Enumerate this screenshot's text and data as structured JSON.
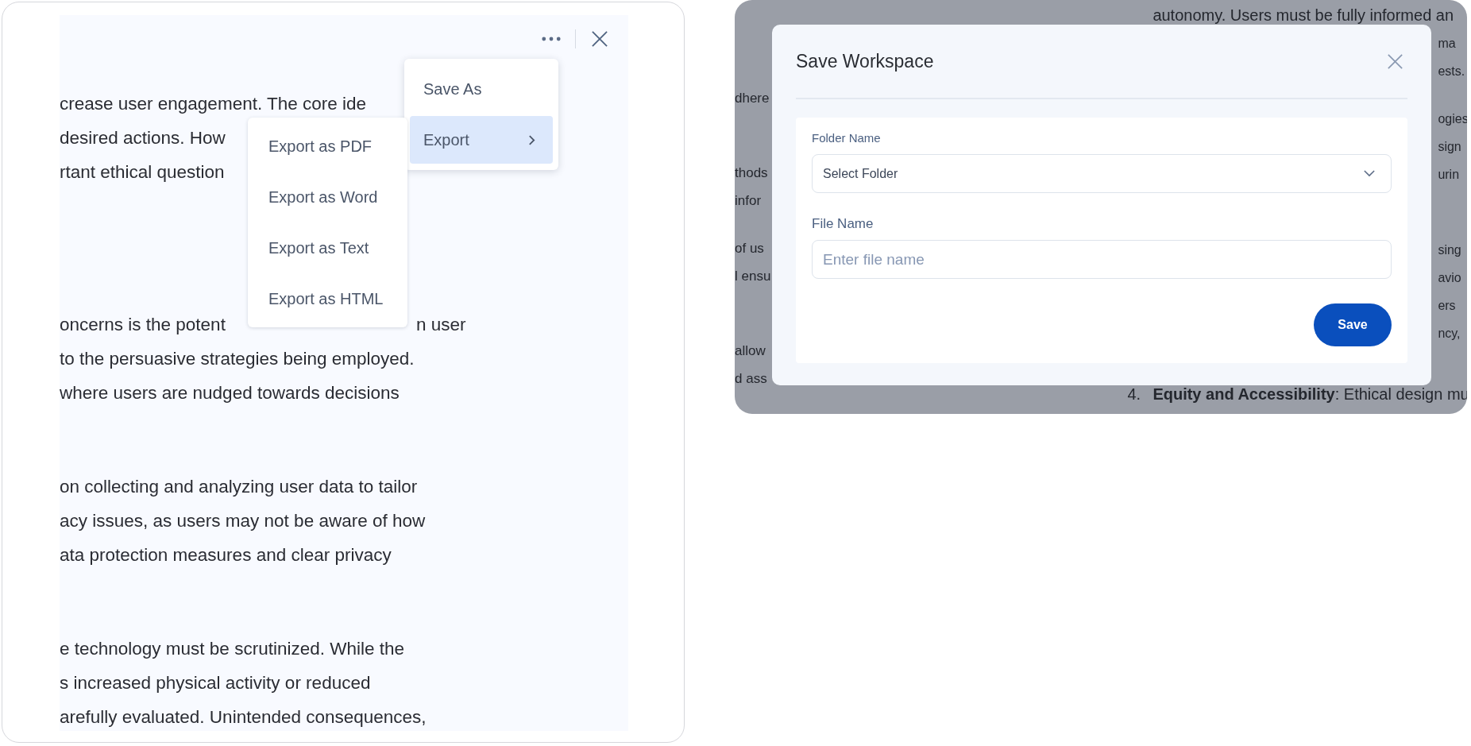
{
  "editor_panel": {
    "paragraphs": [
      [
        {
          "parts": [
            "crease user engagement. The core ide"
          ]
        },
        {
          "parts": [
            "desired actions. How"
          ]
        },
        {
          "parts": [
            "rtant ethical question"
          ]
        }
      ],
      [
        {
          "parts": [
            "oncerns is the potent",
            "n user"
          ]
        },
        {
          "parts": [
            "to the persuasive strategies being employed."
          ]
        },
        {
          "parts": [
            "where users are nudged towards decisions"
          ]
        }
      ],
      [
        {
          "parts": [
            "on collecting and analyzing user data to tailor"
          ]
        },
        {
          "parts": [
            "acy issues, as users may not be aware of how"
          ]
        },
        {
          "parts": [
            "ata protection measures and clear privacy"
          ]
        }
      ],
      [
        {
          "parts": [
            "e technology must be scrutinized. While the"
          ]
        },
        {
          "parts": [
            "s increased physical activity or reduced"
          ]
        },
        {
          "parts": [
            "arefully evaluated. Unintended consequences,"
          ]
        }
      ]
    ],
    "menu": {
      "items": [
        {
          "label": "Save As",
          "selected": false,
          "has_submenu": false
        },
        {
          "label": "Export",
          "selected": true,
          "has_submenu": true
        }
      ]
    },
    "submenu": {
      "items": [
        "Export as PDF",
        "Export as Word",
        "Export as Text",
        "Export as HTML"
      ]
    }
  },
  "save_panel": {
    "background_document": {
      "left_column": [
        [
          "dhere"
        ],
        [
          "thods",
          "infor"
        ],
        [
          "of us",
          "l ensu"
        ],
        [
          "allow",
          "d ass"
        ]
      ],
      "right_column": [
        [
          {
            "kind": "full",
            "text": "autonomy. Users must be fully informed an"
          },
          {
            "kind": "tail",
            "text": "ma"
          },
          {
            "kind": "tail",
            "text": "ests."
          }
        ],
        [
          {
            "kind": "tail",
            "text": "ogies"
          },
          {
            "kind": "tail",
            "text": "sign"
          },
          {
            "kind": "tail",
            "text": "urin"
          }
        ],
        [
          {
            "kind": "tail",
            "text": "sing"
          },
          {
            "kind": "tail",
            "text": "avio"
          },
          {
            "kind": "tail",
            "text": "ers"
          },
          {
            "kind": "tail",
            "text": "ncy,"
          }
        ],
        [
          {
            "kind": "numbered",
            "number": "4.",
            "text": "**Equity and Accessibility**: Ethical design mu"
          }
        ]
      ]
    },
    "dialog": {
      "title": "Save Workspace",
      "fields": [
        {
          "kind": "select",
          "label": "Folder Name",
          "value": "Select Folder"
        },
        {
          "kind": "text",
          "label": "File Name",
          "placeholder": "Enter file name"
        }
      ],
      "buttons": [
        {
          "label": "Save"
        }
      ]
    }
  }
}
